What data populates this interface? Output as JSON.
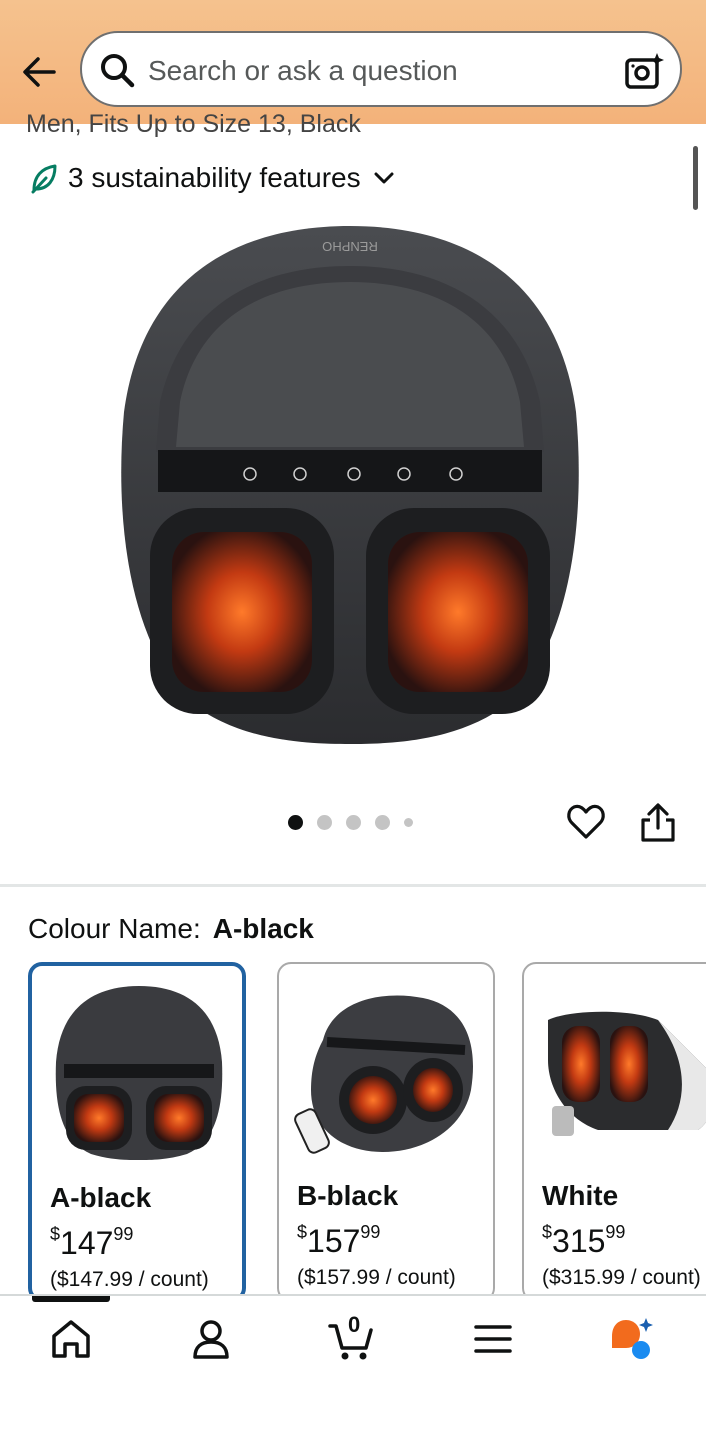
{
  "search": {
    "placeholder": "Search or ask a question"
  },
  "product": {
    "partial_title": "Men, Fits Up to Size 13, Black",
    "sustainability": "3 sustainability features",
    "brand_mark": "RENPHO",
    "image_count": 5,
    "active_image": 1
  },
  "colour": {
    "label": "Colour Name:",
    "selected": "A-black",
    "options": [
      {
        "name": "A-black",
        "price_dollars": "147",
        "price_cents": "99",
        "unit_price": "($147.99 / count)"
      },
      {
        "name": "B-black",
        "price_dollars": "157",
        "price_cents": "99",
        "unit_price": "($157.99 / count)"
      },
      {
        "name": "White",
        "price_dollars": "315",
        "price_cents": "99",
        "unit_price": "($315.99 / count)"
      }
    ]
  },
  "nav": {
    "cart_count": "0",
    "items": [
      "home-icon",
      "account-icon",
      "cart-icon",
      "menu-icon",
      "rufus-icon"
    ]
  },
  "colors": {
    "accent_blue": "#2162a1",
    "header_orange": "#f3b27a",
    "leaf_green": "#067d62"
  }
}
